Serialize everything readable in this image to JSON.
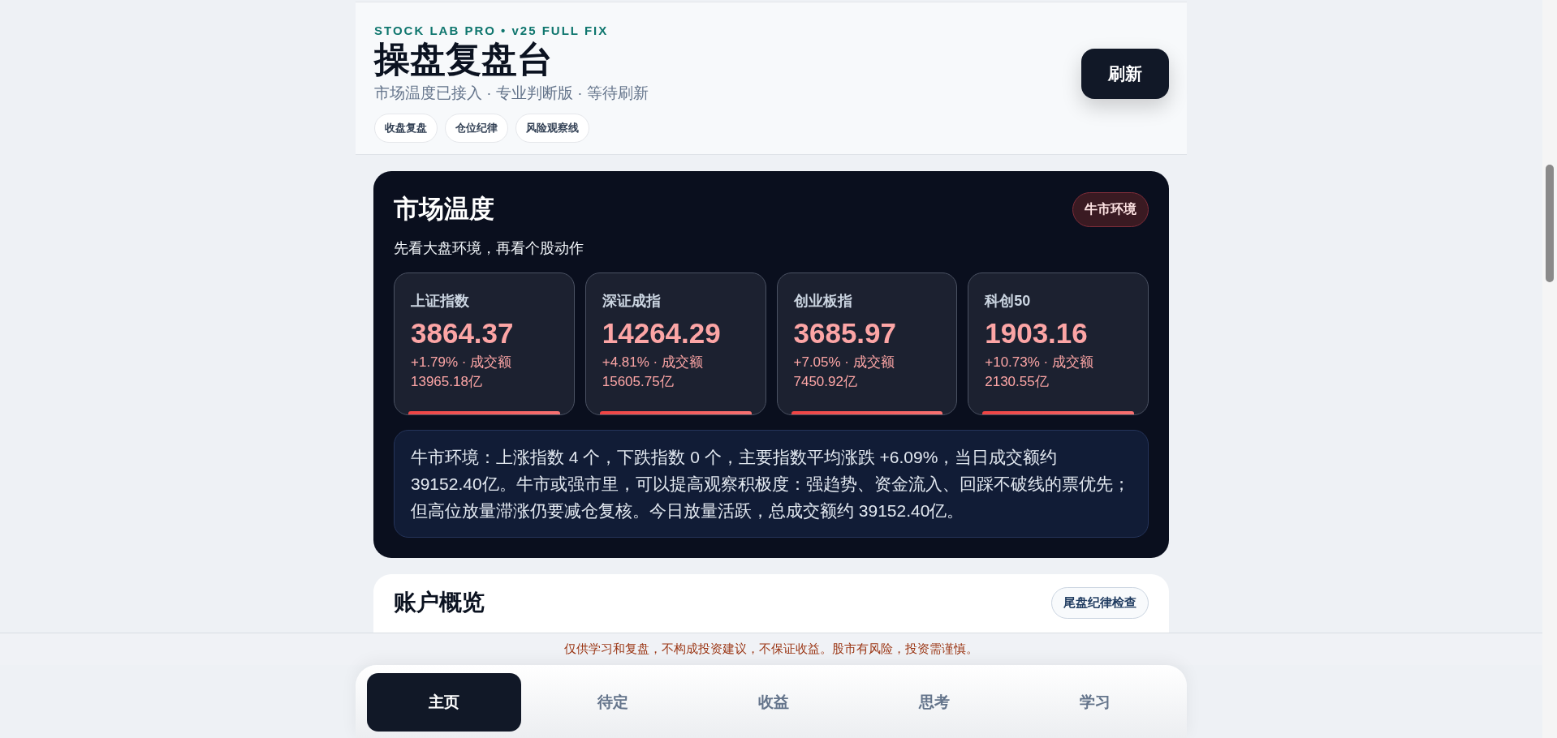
{
  "header": {
    "brand": "STOCK LAB PRO • v25 FULL FIX",
    "title": "操盘复盘台",
    "subtitle": "市场温度已接入 · 专业判断版 · 等待刷新",
    "chips": [
      "收盘复盘",
      "仓位纪律",
      "风险观察线"
    ],
    "refresh_button": "刷新"
  },
  "market": {
    "title": "市场温度",
    "badge": "牛市环境",
    "subtitle": "先看大盘环境，再看个股动作",
    "indices": [
      {
        "name": "上证指数",
        "value": "3864.37",
        "change": "+1.79% · 成交额 13965.18亿"
      },
      {
        "name": "深证成指",
        "value": "14264.29",
        "change": "+4.81% · 成交额 15605.75亿"
      },
      {
        "name": "创业板指",
        "value": "3685.97",
        "change": "+7.05% · 成交额 7450.92亿"
      },
      {
        "name": "科创50",
        "value": "1903.16",
        "change": "+10.73% · 成交额 2130.55亿"
      }
    ],
    "summary": "牛市环境：上涨指数 4 个，下跌指数 0 个，主要指数平均涨跌 +6.09%，当日成交额约 39152.40亿。牛市或强市里，可以提高观察积极度：强趋势、资金流入、回踩不破线的票优先；但高位放量滞涨仍要减仓复核。今日放量活跃，总成交额约 39152.40亿。"
  },
  "account": {
    "title": "账户概览",
    "button": "尾盘纪律检查"
  },
  "disclaimer": "仅供学习和复盘，不构成投资建议，不保证收益。股市有风险，投资需谨慎。",
  "nav": [
    {
      "label": "主页",
      "selected": true
    },
    {
      "label": "待定",
      "selected": false
    },
    {
      "label": "收益",
      "selected": false
    },
    {
      "label": "思考",
      "selected": false
    },
    {
      "label": "学习",
      "selected": false
    }
  ]
}
